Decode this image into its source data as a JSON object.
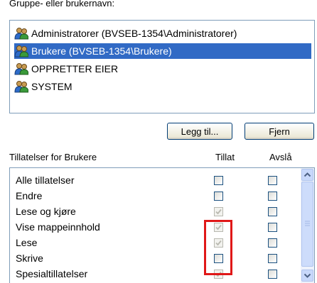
{
  "group_section": {
    "label": "Gruppe- eller brukernavn:",
    "items": [
      {
        "name": "Administratorer (BVSEB-1354\\Administratorer)",
        "selected": false
      },
      {
        "name": "Brukere (BVSEB-1354\\Brukere)",
        "selected": true
      },
      {
        "name": "OPPRETTER EIER",
        "selected": false
      },
      {
        "name": "SYSTEM",
        "selected": false
      }
    ]
  },
  "buttons": {
    "add_label": "Legg til...",
    "remove_label": "Fjern"
  },
  "permissions": {
    "title": "Tillatelser for Brukere",
    "allow_header": "Tillat",
    "deny_header": "Avslå",
    "rows": [
      {
        "name": "Alle tillatelser",
        "allow": false,
        "allow_disabled": false,
        "deny": false
      },
      {
        "name": "Endre",
        "allow": false,
        "allow_disabled": false,
        "deny": false
      },
      {
        "name": "Lese og kjøre",
        "allow": true,
        "allow_disabled": true,
        "deny": false
      },
      {
        "name": "Vise mappeinnhold",
        "allow": true,
        "allow_disabled": true,
        "deny": false
      },
      {
        "name": "Lese",
        "allow": true,
        "allow_disabled": true,
        "deny": false
      },
      {
        "name": "Skrive",
        "allow": false,
        "allow_disabled": false,
        "deny": false
      },
      {
        "name": "Spesialtillatelser",
        "allow": true,
        "allow_disabled": true,
        "deny": false
      }
    ]
  },
  "colors": {
    "selection": "#316ac5",
    "highlight_box": "#e01818",
    "list_border": "#7f9db9"
  }
}
